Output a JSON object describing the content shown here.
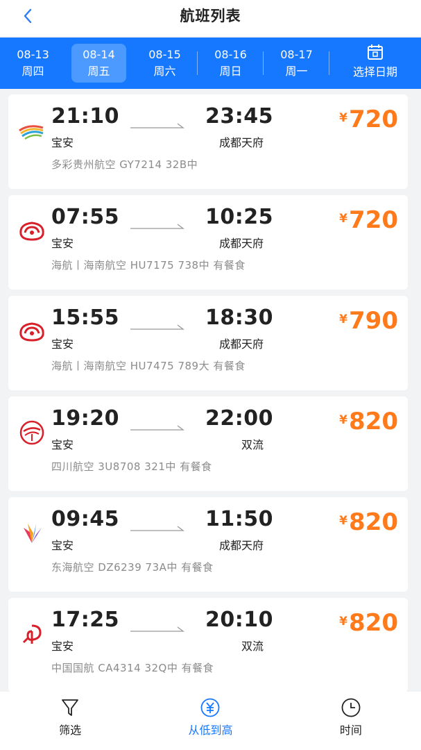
{
  "header": {
    "title": "航班列表"
  },
  "dates": [
    {
      "date": "08-13",
      "weekday": "周四",
      "active": false
    },
    {
      "date": "08-14",
      "weekday": "周五",
      "active": true
    },
    {
      "date": "08-15",
      "weekday": "周六",
      "active": false
    },
    {
      "date": "08-16",
      "weekday": "周日",
      "active": false
    },
    {
      "date": "08-17",
      "weekday": "周一",
      "active": false
    }
  ],
  "pick_date_label": "选择日期",
  "currency": "¥",
  "flights": [
    {
      "dep_time": "21:10",
      "dep_airport": "宝安",
      "arr_time": "23:45",
      "arr_airport": "成都天府",
      "price": "720",
      "info": "多彩贵州航空 GY7214 32B中",
      "logo": "gy-logo-icon"
    },
    {
      "dep_time": "07:55",
      "dep_airport": "宝安",
      "arr_time": "10:25",
      "arr_airport": "成都天府",
      "price": "720",
      "info": "海航丨海南航空 HU7175 738中 有餐食",
      "logo": "hu-logo-icon"
    },
    {
      "dep_time": "15:55",
      "dep_airport": "宝安",
      "arr_time": "18:30",
      "arr_airport": "成都天府",
      "price": "790",
      "info": "海航丨海南航空 HU7475 789大 有餐食",
      "logo": "hu-logo-icon"
    },
    {
      "dep_time": "19:20",
      "dep_airport": "宝安",
      "arr_time": "22:00",
      "arr_airport": "双流",
      "price": "820",
      "info": "四川航空 3U8708 321中 有餐食",
      "logo": "3u-logo-icon"
    },
    {
      "dep_time": "09:45",
      "dep_airport": "宝安",
      "arr_time": "11:50",
      "arr_airport": "成都天府",
      "price": "820",
      "info": "东海航空 DZ6239 73A中 有餐食",
      "logo": "dz-logo-icon"
    },
    {
      "dep_time": "17:25",
      "dep_airport": "宝安",
      "arr_time": "20:10",
      "arr_airport": "双流",
      "price": "820",
      "info": "中国国航 CA4314 32Q中 有餐食",
      "logo": "ca-logo-icon"
    }
  ],
  "bottom_nav": [
    {
      "label": "筛选",
      "icon": "filter-icon",
      "active": false
    },
    {
      "label": "从低到高",
      "icon": "yuan-sort-icon",
      "active": true
    },
    {
      "label": "时间",
      "icon": "clock-icon",
      "active": false
    }
  ],
  "colors": {
    "primary": "#1677ff",
    "price": "#ff7a1a",
    "muted": "#8b8b8b"
  }
}
